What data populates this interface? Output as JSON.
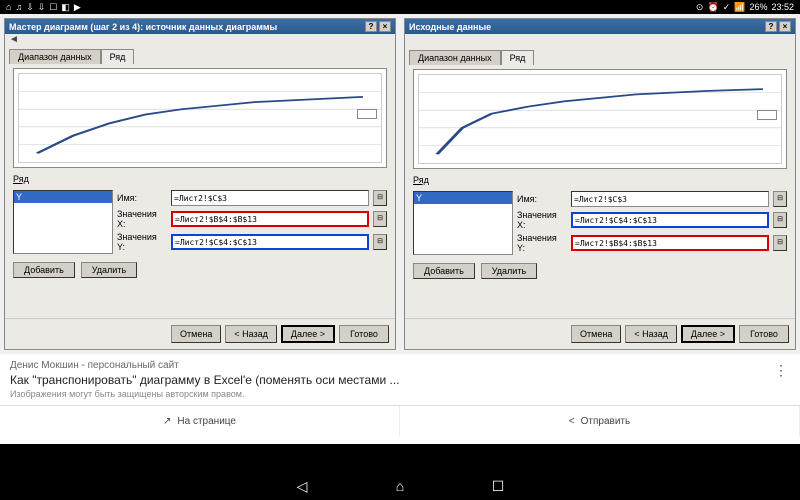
{
  "statusbar": {
    "time": "23:52",
    "battery": "26%",
    "icons_left": [
      "⌂",
      "♫",
      "⇩",
      "⇩",
      "☐",
      "◧",
      "▶"
    ],
    "icons_right": [
      "⊙",
      "⏰",
      "✓",
      "📶",
      "◪"
    ]
  },
  "dialogs": [
    {
      "title": "Мастер диаграмм (шаг 2 из 4): источник данных диаграммы",
      "tabs": {
        "inactive": "Диапазон данных",
        "active": "Ряд"
      },
      "section": "Ряд",
      "series_item": "Y",
      "fields": {
        "name": {
          "label": "Имя:",
          "value": "=Лист2!$C$3",
          "hl": ""
        },
        "x": {
          "label": "Значения X:",
          "value": "=Лист2!$B$4:$B$13",
          "hl": "red"
        },
        "y": {
          "label": "Значения Y:",
          "value": "=Лист2!$C$4:$C$13",
          "hl": "blue"
        }
      },
      "btns": {
        "add": "Добавить",
        "del": "Удалить"
      },
      "footer": {
        "cancel": "Отмена",
        "back": "< Назад",
        "next": "Далее >",
        "finish": "Готово"
      }
    },
    {
      "title": "Исходные данные",
      "tabs": {
        "inactive": "Диапазон данных",
        "active": "Ряд"
      },
      "section": "Ряд",
      "series_item": "Y",
      "fields": {
        "name": {
          "label": "Имя:",
          "value": "=Лист2!$C$3",
          "hl": ""
        },
        "x": {
          "label": "Значения X:",
          "value": "=Лист2!$C$4:$C$13",
          "hl": "blue"
        },
        "y": {
          "label": "Значения Y:",
          "value": "=Лист2!$B$4:$B$13",
          "hl": "red"
        }
      },
      "btns": {
        "add": "Добавить",
        "del": "Удалить"
      },
      "footer": {
        "cancel": "Отмена",
        "back": "< Назад",
        "next": "Далее >",
        "finish": "Готово"
      }
    }
  ],
  "chart_data": {
    "type": "line",
    "x": [
      1,
      2,
      3,
      4,
      5,
      6,
      7,
      8,
      9,
      10
    ],
    "values": [
      4,
      8,
      10,
      12,
      13,
      13.5,
      14,
      14.3,
      14.6,
      15
    ],
    "ylim": [
      0,
      18
    ],
    "xlim": [
      0,
      12
    ],
    "series_name": "Y"
  },
  "result": {
    "site": "Денис Мокшин - персональный сайт",
    "title": "Как \"транспонировать\" диаграмму в Excel'е (поменять оси местами ...",
    "sub": "Изображения могут быть защищены авторским правом."
  },
  "actions": {
    "page": "На странице",
    "share": "Отправить"
  }
}
